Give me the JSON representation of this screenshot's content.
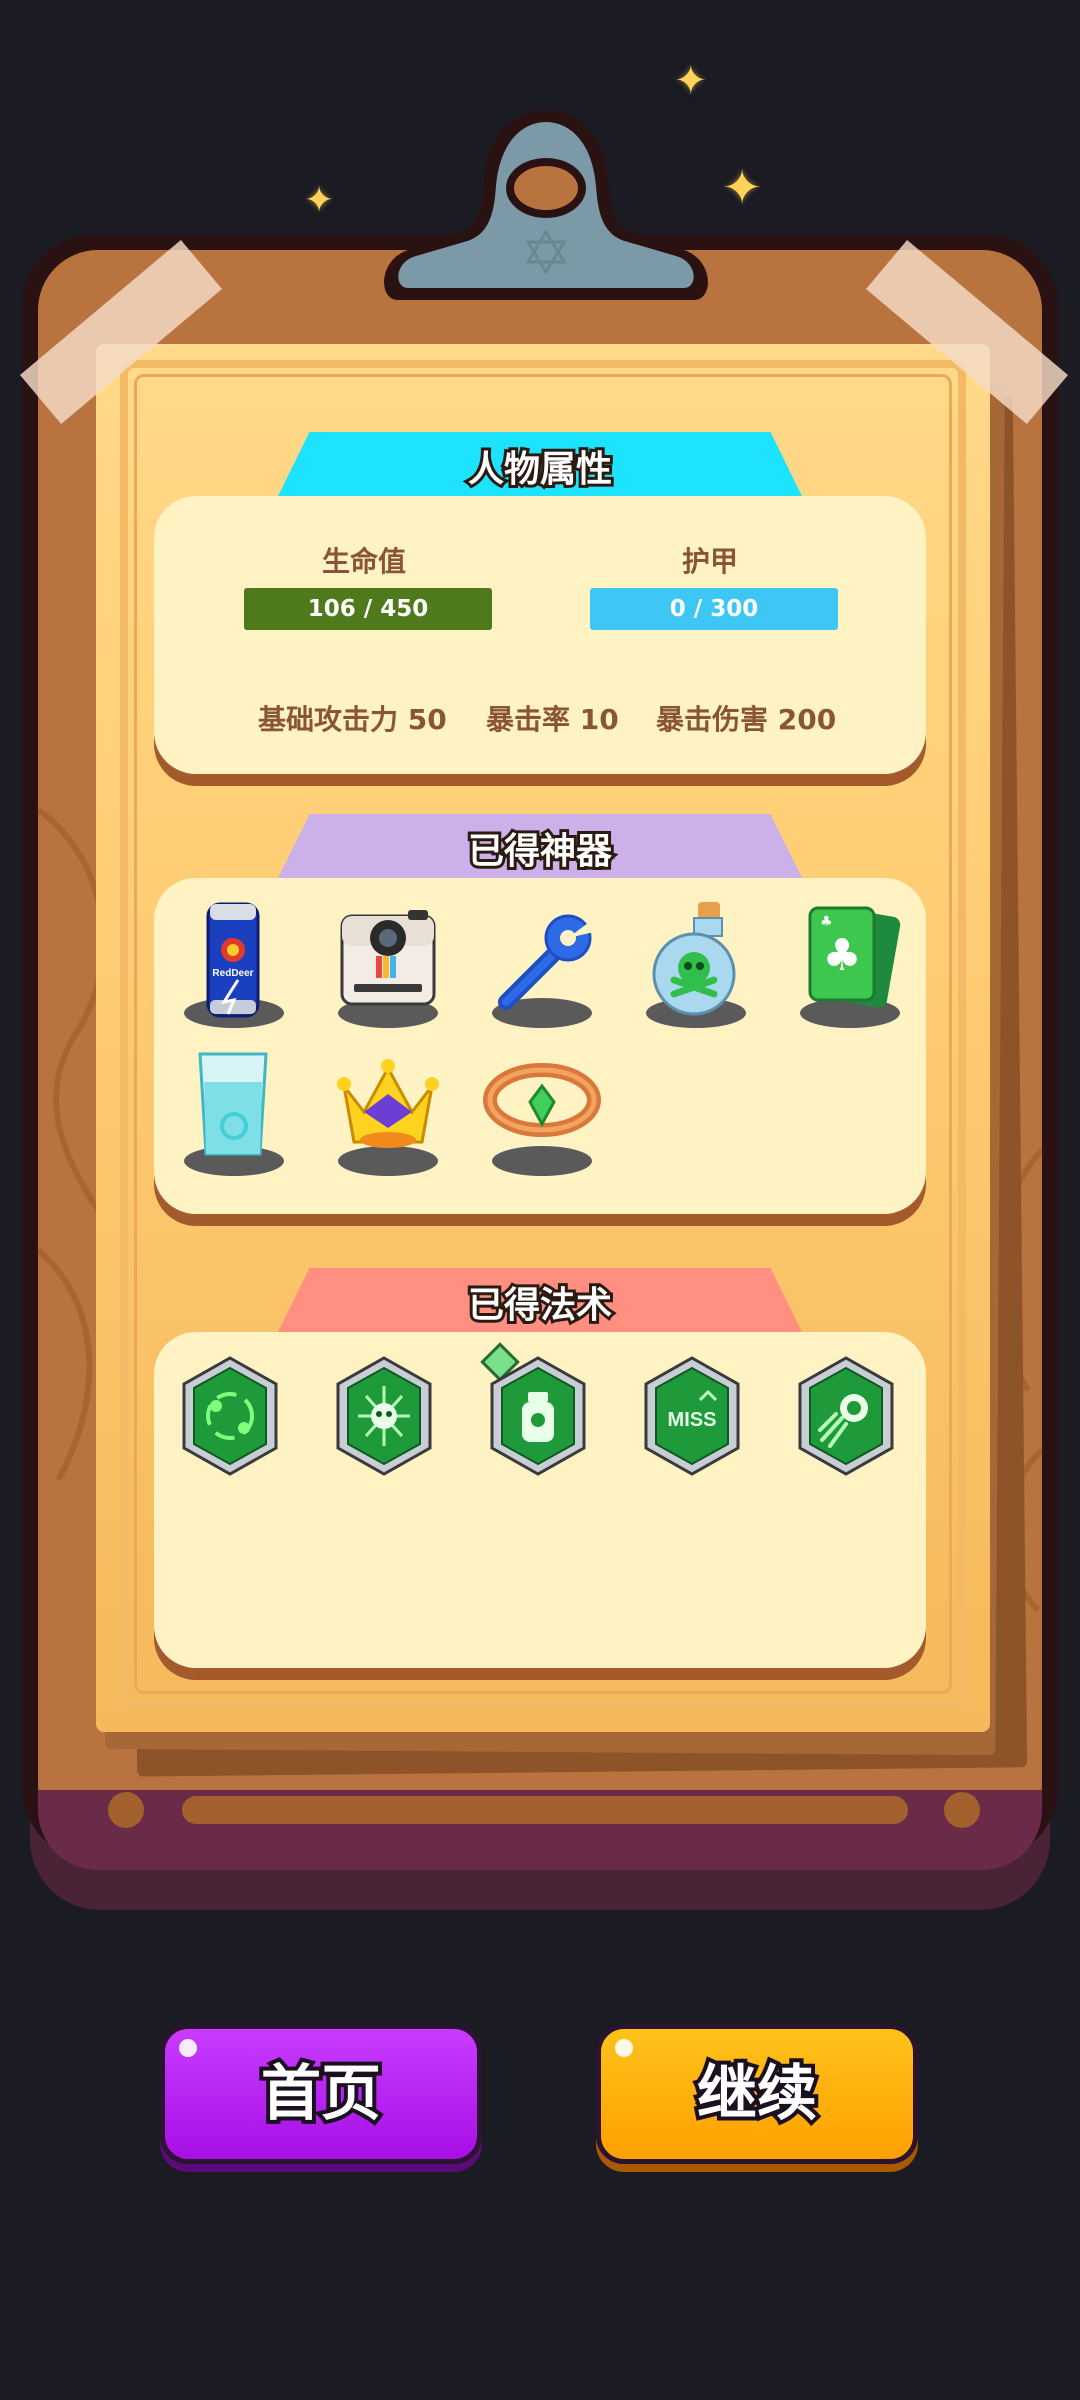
{
  "character_stats": {
    "title": "人物属性",
    "hp_label": "生命值",
    "hp_value": "106 / 450",
    "hp_fraction": 0.2356,
    "armor_label": "护甲",
    "armor_value": "0 / 300",
    "armor_fraction": 0,
    "base_attack": "基础攻击力 50",
    "crit_rate": "暴击率 10",
    "crit_damage": "暴击伤害 200"
  },
  "artifacts": {
    "title": "已得神器",
    "items": [
      {
        "icon": "energy-drink-can-icon",
        "label": "RedDeer"
      },
      {
        "icon": "instant-camera-icon"
      },
      {
        "icon": "wrench-icon"
      },
      {
        "icon": "poison-potion-icon"
      },
      {
        "icon": "club-cards-icon"
      },
      {
        "icon": "glass-of-water-icon"
      },
      {
        "icon": "golden-crown-icon"
      },
      {
        "icon": "emerald-ring-icon"
      }
    ]
  },
  "spells": {
    "title": "已得法术",
    "items": [
      {
        "icon": "orbit-spell-icon"
      },
      {
        "icon": "skull-burst-spell-icon"
      },
      {
        "icon": "poison-bottle-spell-icon"
      },
      {
        "icon": "miss-spell-icon",
        "label": "MISS"
      },
      {
        "icon": "comet-spell-icon"
      }
    ]
  },
  "buttons": {
    "home_label": "首页",
    "continue_label": "继续"
  },
  "colors": {
    "hp_bar": "#4e7a1c",
    "armor_bar": "#3ec7f5",
    "home_button": "#b516f2",
    "continue_button": "#ffa800",
    "stats_tab": "#1ee3ff",
    "artifacts_tab": "#cbb0ea",
    "spells_tab": "#ff8f80"
  }
}
